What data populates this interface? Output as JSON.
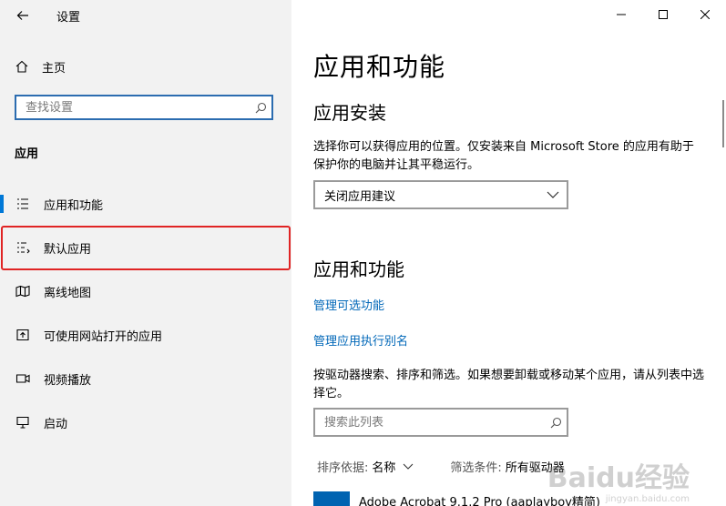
{
  "window": {
    "title": "设置"
  },
  "sidebar": {
    "home_label": "主页",
    "search_placeholder": "查找设置",
    "section_label": "应用",
    "items": [
      {
        "label": "应用和功能",
        "icon": "apps-list-icon",
        "active": true
      },
      {
        "label": "默认应用",
        "icon": "default-apps-icon"
      },
      {
        "label": "离线地图",
        "icon": "map-icon"
      },
      {
        "label": "可使用网站打开的应用",
        "icon": "web-apps-icon"
      },
      {
        "label": "视频播放",
        "icon": "video-icon"
      },
      {
        "label": "启动",
        "icon": "startup-icon"
      }
    ]
  },
  "main": {
    "title": "应用和功能",
    "install_heading": "应用安装",
    "install_desc": "选择你可以获得应用的位置。仅安装来自 Microsoft Store 的应用有助于保护你的电脑并让其平稳运行。",
    "install_dropdown_value": "关闭应用建议",
    "apps_heading": "应用和功能",
    "link_optional_features": "管理可选功能",
    "link_app_aliases": "管理应用执行别名",
    "search_desc": "按驱动器搜索、排序和筛选。如果想要卸载或移动某个应用，请从列表中选择它。",
    "search_placeholder": "搜索此列表",
    "sort_label": "排序依据:",
    "sort_value": "名称",
    "filter_label": "筛选条件:",
    "filter_value": "所有驱动器",
    "first_app": "Adobe Acrobat 9.1.2 Pro (aaplayboy精简)"
  },
  "watermark": {
    "text": "Baidu经验",
    "sub": "jingyan.baidu.com"
  },
  "colors": {
    "accent": "#0078d7",
    "link": "#0067b8",
    "highlight": "#e02424",
    "sidebar_bg": "#f2f2f2"
  }
}
